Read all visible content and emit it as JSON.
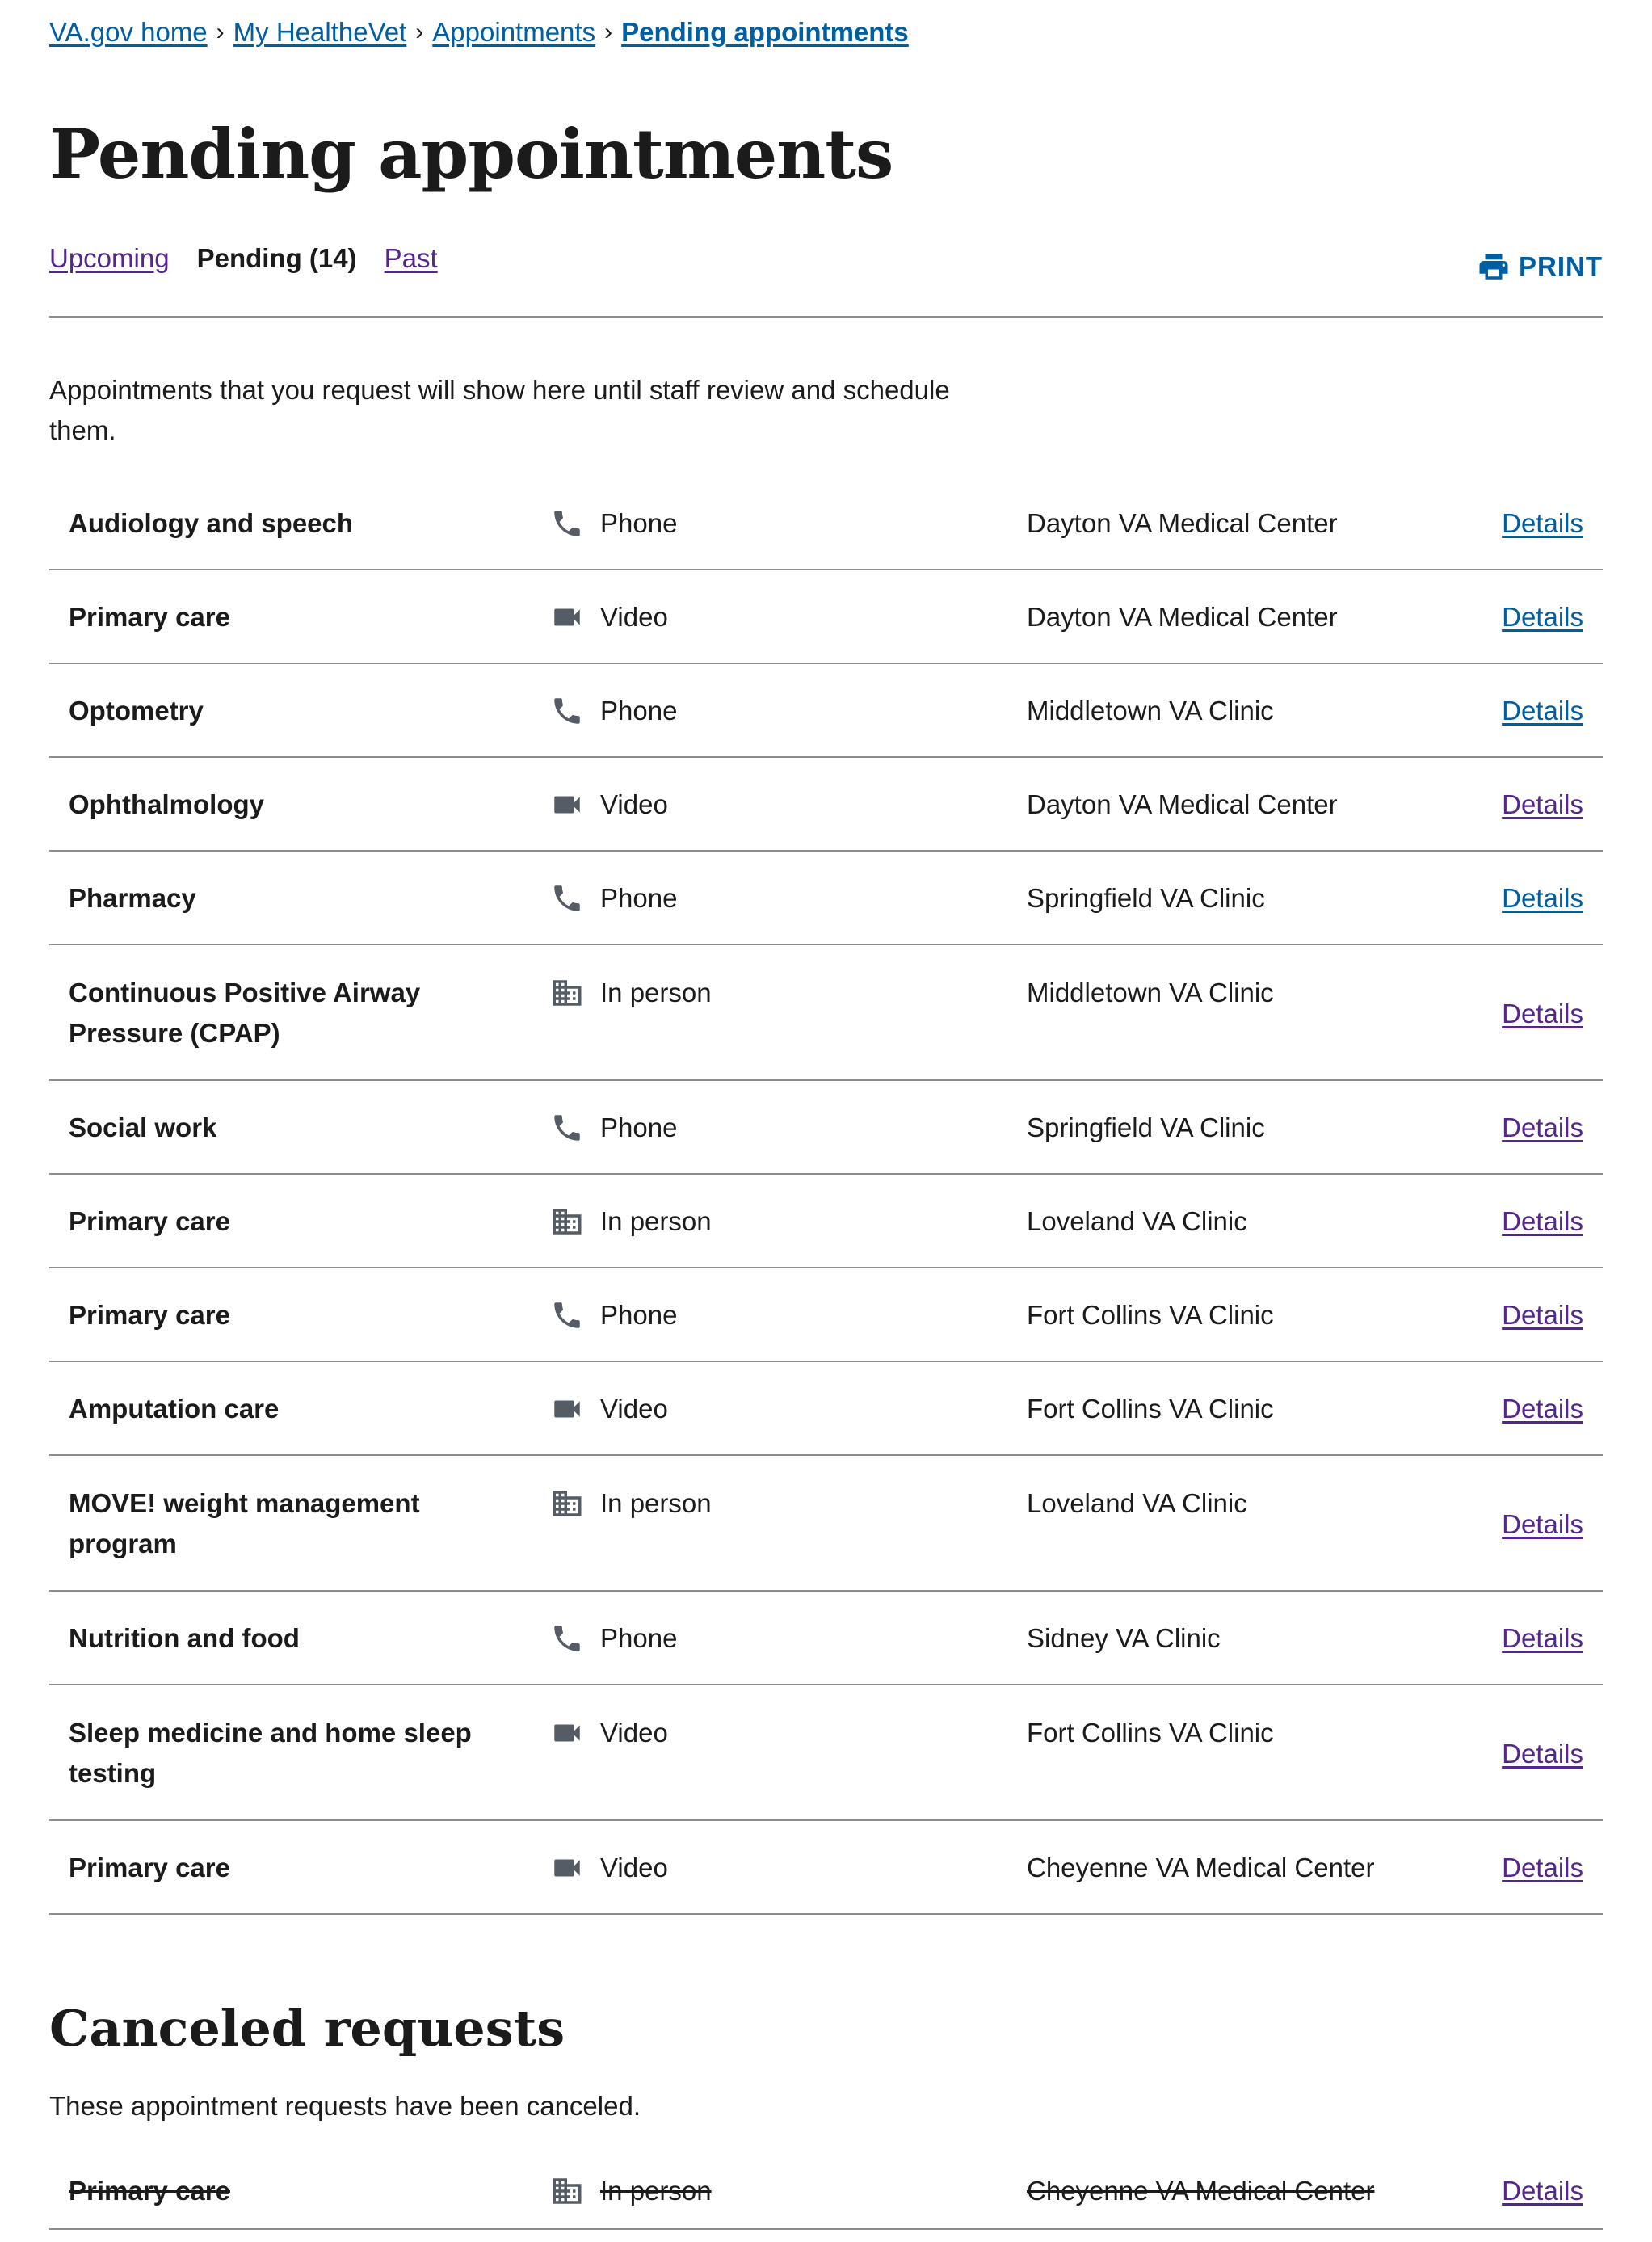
{
  "breadcrumb": {
    "items": [
      "VA.gov home",
      "My HealtheVet",
      "Appointments"
    ],
    "current": "Pending appointments"
  },
  "page_title": "Pending appointments",
  "tabs": {
    "upcoming": "Upcoming",
    "pending": "Pending (14)",
    "past": "Past"
  },
  "print_label": "PRINT",
  "intro": "Appointments that you request will show here until staff review and schedule them.",
  "details_label": "Details",
  "colors": {
    "link": "#005ea2",
    "visited_link": "#54278f",
    "icon": "#565c65",
    "rule": "#8d8d8d"
  },
  "appointments": [
    {
      "type": "Audiology and speech",
      "mode": "Phone",
      "mode_icon": "phone-icon",
      "location": "Dayton VA Medical Center"
    },
    {
      "type": "Primary care",
      "mode": "Video",
      "mode_icon": "video-camera-icon",
      "location": "Dayton VA Medical Center"
    },
    {
      "type": "Optometry",
      "mode": "Phone",
      "mode_icon": "phone-icon",
      "location": "Middletown VA Clinic"
    },
    {
      "type": "Ophthalmology",
      "mode": "Video",
      "mode_icon": "video-camera-icon",
      "location": "Dayton VA Medical Center"
    },
    {
      "type": "Pharmacy",
      "mode": "Phone",
      "mode_icon": "phone-icon",
      "location": "Springfield VA Clinic"
    },
    {
      "type": "Continuous Positive Airway Pressure (CPAP)",
      "mode": "In person",
      "mode_icon": "building-icon",
      "location": "Middletown VA Clinic"
    },
    {
      "type": "Social work",
      "mode": "Phone",
      "mode_icon": "phone-icon",
      "location": "Springfield VA Clinic"
    },
    {
      "type": "Primary care",
      "mode": "In person",
      "mode_icon": "building-icon",
      "location": "Loveland VA Clinic"
    },
    {
      "type": "Primary care",
      "mode": "Phone",
      "mode_icon": "phone-icon",
      "location": "Fort Collins VA Clinic"
    },
    {
      "type": "Amputation care",
      "mode": "Video",
      "mode_icon": "video-camera-icon",
      "location": "Fort Collins VA Clinic"
    },
    {
      "type": "MOVE! weight management program",
      "mode": "In person",
      "mode_icon": "building-icon",
      "location": "Loveland VA Clinic"
    },
    {
      "type": "Nutrition and food",
      "mode": "Phone",
      "mode_icon": "phone-icon",
      "location": "Sidney VA Clinic"
    },
    {
      "type": "Sleep medicine and home sleep testing",
      "mode": "Video",
      "mode_icon": "video-camera-icon",
      "location": "Fort Collins VA Clinic"
    },
    {
      "type": "Primary care",
      "mode": "Video",
      "mode_icon": "video-camera-icon",
      "location": "Cheyenne VA Medical Center"
    }
  ],
  "canceled": {
    "title": "Canceled requests",
    "intro": "These appointment requests have been canceled.",
    "items": [
      {
        "type": "Primary care",
        "mode": "In person",
        "mode_icon": "building-icon",
        "location": "Cheyenne VA Medical Center"
      }
    ]
  }
}
